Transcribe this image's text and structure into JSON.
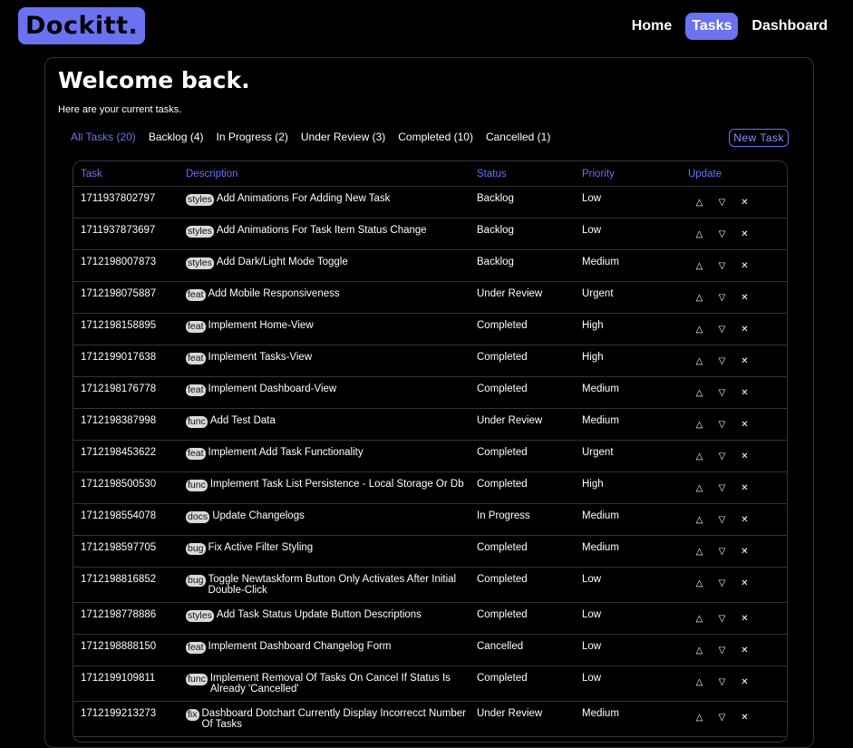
{
  "brand": "Dockitt.",
  "nav": [
    {
      "label": "Home",
      "active": false
    },
    {
      "label": "Tasks",
      "active": true
    },
    {
      "label": "Dashboard",
      "active": false
    }
  ],
  "welcome": "Welcome back.",
  "subtitle": "Here are your current tasks.",
  "filters": [
    {
      "label": "All Tasks (20)",
      "active": true
    },
    {
      "label": "Backlog (4)",
      "active": false
    },
    {
      "label": "In Progress (2)",
      "active": false
    },
    {
      "label": "Under Review (3)",
      "active": false
    },
    {
      "label": "Completed (10)",
      "active": false
    },
    {
      "label": "Cancelled (1)",
      "active": false
    }
  ],
  "new_task_label": "New Task",
  "columns": [
    "Task",
    "Description",
    "Status",
    "Priority",
    "Update"
  ],
  "update_icons": {
    "up": "△",
    "down": "▽",
    "cancel": "✕"
  },
  "rows": [
    {
      "id": "1711937802797",
      "tag": "styles",
      "desc": "Add Animations For Adding New Task",
      "status": "Backlog",
      "priority": "Low"
    },
    {
      "id": "1711937873697",
      "tag": "styles",
      "desc": "Add Animations For Task Item Status Change",
      "status": "Backlog",
      "priority": "Low"
    },
    {
      "id": "1712198007873",
      "tag": "styles",
      "desc": "Add Dark/Light Mode Toggle",
      "status": "Backlog",
      "priority": "Medium"
    },
    {
      "id": "1712198075887",
      "tag": "feat",
      "desc": "Add Mobile Responsiveness",
      "status": "Under Review",
      "priority": "Urgent"
    },
    {
      "id": "1712198158895",
      "tag": "feat",
      "desc": "Implement Home-View",
      "status": "Completed",
      "priority": "High"
    },
    {
      "id": "1712199017638",
      "tag": "feat",
      "desc": "Implement Tasks-View",
      "status": "Completed",
      "priority": "High"
    },
    {
      "id": "1712198176778",
      "tag": "feat",
      "desc": "Implement Dashboard-View",
      "status": "Completed",
      "priority": "Medium"
    },
    {
      "id": "1712198387998",
      "tag": "func",
      "desc": "Add Test Data",
      "status": "Under Review",
      "priority": "Medium"
    },
    {
      "id": "1712198453622",
      "tag": "feat",
      "desc": "Implement Add Task Functionality",
      "status": "Completed",
      "priority": "Urgent"
    },
    {
      "id": "1712198500530",
      "tag": "func",
      "desc": "Implement Task List Persistence - Local Storage Or Db",
      "status": "Completed",
      "priority": "High"
    },
    {
      "id": "1712198554078",
      "tag": "docs",
      "desc": "Update Changelogs",
      "status": "In Progress",
      "priority": "Medium"
    },
    {
      "id": "1712198597705",
      "tag": "bug",
      "desc": "Fix Active Filter Styling",
      "status": "Completed",
      "priority": "Medium"
    },
    {
      "id": "1712198816852",
      "tag": "bug",
      "desc": "Toggle Newtaskform Button Only Activates After Initial Double-Click",
      "status": "Completed",
      "priority": "Low"
    },
    {
      "id": "1712198778886",
      "tag": "styles",
      "desc": "Add Task Status Update Button Descriptions",
      "status": "Completed",
      "priority": "Low"
    },
    {
      "id": "1712198888150",
      "tag": "feat",
      "desc": "Implement Dashboard Changelog Form",
      "status": "Cancelled",
      "priority": "Low"
    },
    {
      "id": "1712199109811",
      "tag": "func",
      "desc": "Implement Removal Of Tasks On Cancel If Status Is Already 'Cancelled'",
      "status": "Completed",
      "priority": "Low"
    },
    {
      "id": "1712199213273",
      "tag": "fix",
      "desc": "Dashboard Dotchart Currently Display Incorrecct Number Of Tasks",
      "status": "Under Review",
      "priority": "Medium"
    }
  ],
  "colors": {
    "accent": "#6b72f2",
    "background": "#000000",
    "tag_bg": "#d9d9d9"
  }
}
